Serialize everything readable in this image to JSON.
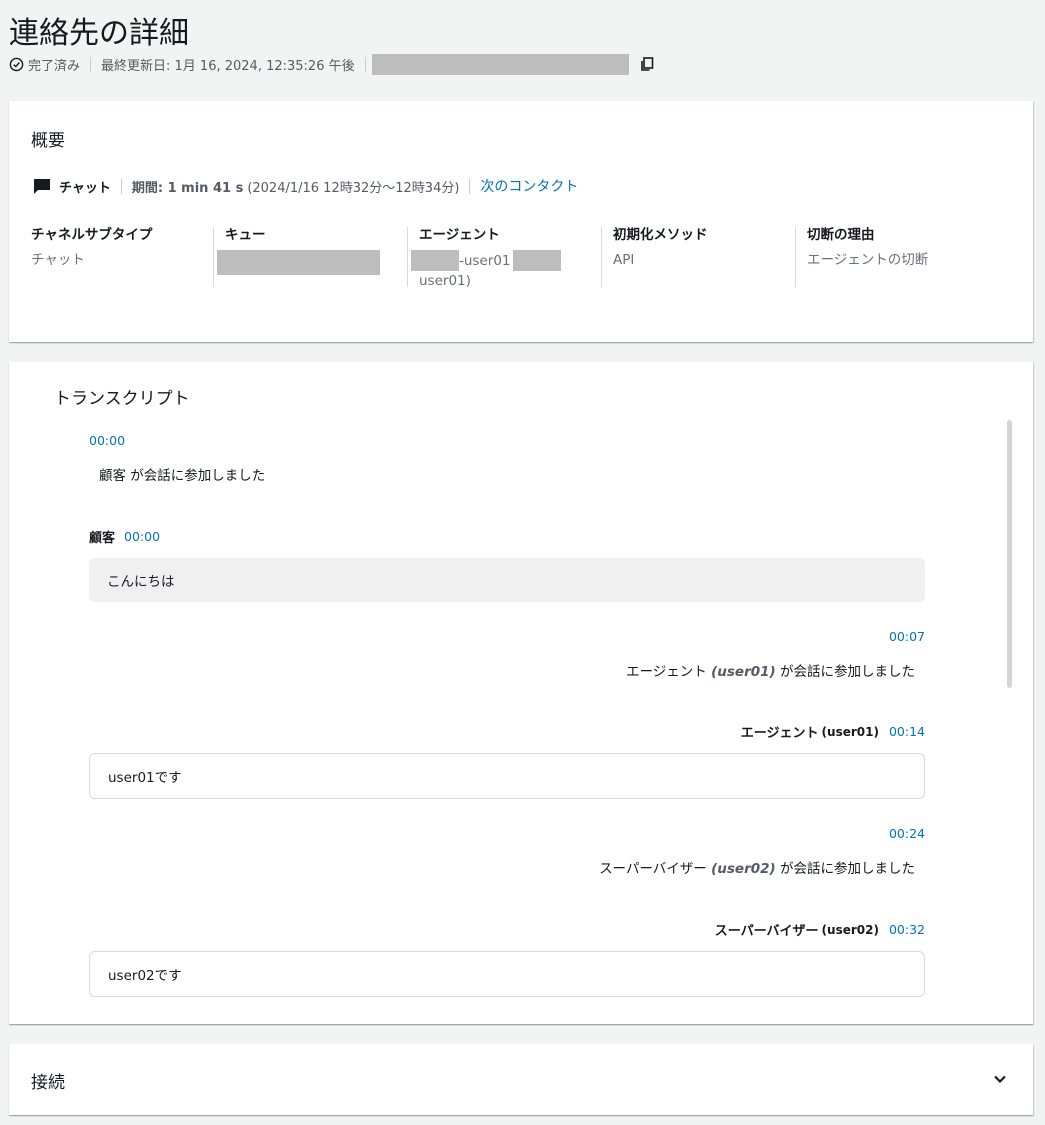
{
  "page": {
    "title": "連絡先の詳細",
    "status": "完了済み",
    "last_updated": "最終更新日: 1月 16, 2024, 12:35:26 午後"
  },
  "overview": {
    "title": "概要",
    "channel": "チャット",
    "duration_label": "期間: 1 min 41 s",
    "duration_range": "(2024/1/16 12時32分～12時34分)",
    "next_contact_link": "次のコンタクト",
    "columns": [
      {
        "header": "チャネルサブタイプ",
        "value": "チャット"
      },
      {
        "header": "キュー",
        "value": ""
      },
      {
        "header": "エージェント",
        "value_line1": "-user01",
        "value_line2": "user01)"
      },
      {
        "header": "初期化メソッド",
        "value": "API"
      },
      {
        "header": "切断の理由",
        "value": "エージェントの切断"
      }
    ]
  },
  "transcript": {
    "title": "トランスクリプト",
    "events": [
      {
        "time": "00:00",
        "text": "顧客 が会話に参加しました"
      },
      {
        "sender": "顧客",
        "time": "00:00",
        "message": "こんにちは"
      },
      {
        "time": "00:07",
        "role": "エージェント",
        "user": "(user01)",
        "suffix": "が会話に参加しました"
      },
      {
        "sender": "エージェント",
        "sender_detail": "(user01)",
        "time": "00:14",
        "message": "user01です"
      },
      {
        "time": "00:24",
        "role": "スーパーバイザー",
        "user": "(user02)",
        "suffix": "が会話に参加しました"
      },
      {
        "sender": "スーパーバイザー",
        "sender_detail": "(user02)",
        "time": "00:32",
        "message": "user02です"
      }
    ]
  },
  "connection": {
    "title": "接続"
  },
  "colors": {
    "link": "#0073bb",
    "background": "#f2f3f3",
    "customer_bubble": "#f0f0f0",
    "redacted": "#bdbdbd"
  }
}
